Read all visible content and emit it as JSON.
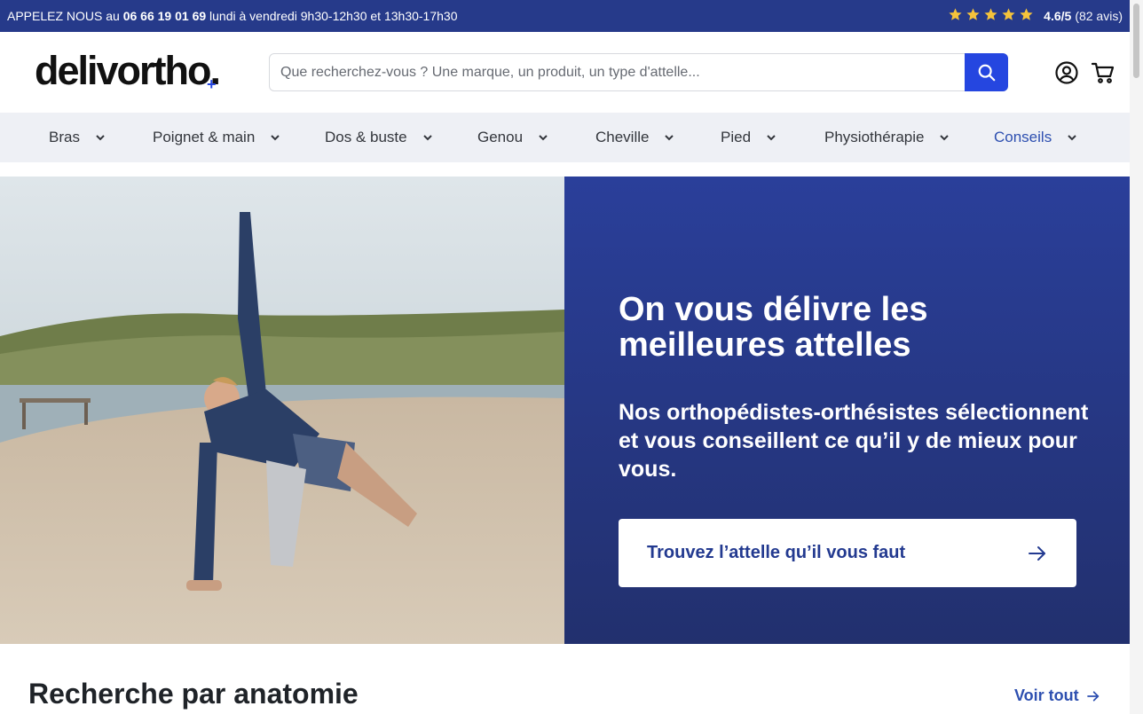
{
  "topbar": {
    "call_prefix": "APPELEZ NOUS au ",
    "phone": "06 66 19 01 69",
    "hours": " lundi à vendredi 9h30-12h30 et 13h30-17h30",
    "rating_score": "4.6/5",
    "rating_count": "(82 avis)",
    "stars": 5,
    "star_color": "#f5c33b"
  },
  "header": {
    "logo": "delivortho.",
    "logo_plus": "+",
    "search_placeholder": "Que recherchez-vous ? Une marque, un produit, un type d'attelle...",
    "accent_color": "#2546e0"
  },
  "nav": {
    "items": [
      {
        "label": "Bras",
        "active": false
      },
      {
        "label": "Poignet & main",
        "active": false
      },
      {
        "label": "Dos & buste",
        "active": false
      },
      {
        "label": "Genou",
        "active": false
      },
      {
        "label": "Cheville",
        "active": false
      },
      {
        "label": "Pied",
        "active": false
      },
      {
        "label": "Physiothérapie",
        "active": false
      },
      {
        "label": "Conseils",
        "active": true
      }
    ]
  },
  "hero": {
    "title": "On vous délivre les meilleures attelles",
    "subtitle": "Nos orthopédistes-orthésistes sélectionnent et vous conseillent ce qu’il y de mieux pour vous.",
    "cta_label": "Trouvez l’attelle qu’il vous faut"
  },
  "section": {
    "title": "Recherche par anatomie",
    "see_all": "Voir tout"
  }
}
